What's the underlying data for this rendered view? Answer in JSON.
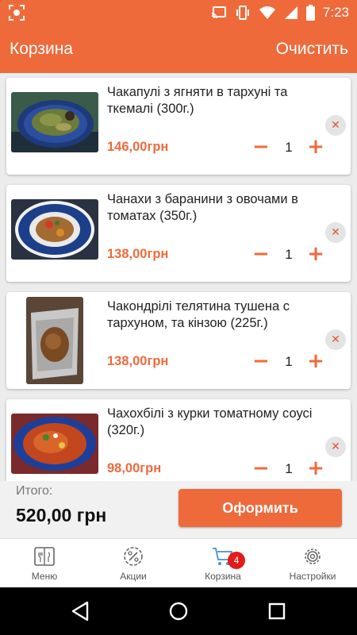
{
  "status_bar": {
    "time": "7:23"
  },
  "header": {
    "title": "Корзина",
    "clear_label": "Очистить"
  },
  "cart": {
    "items": [
      {
        "name": "Чакапулі з ягняти в тархуні та ткемалі (300г.)",
        "price": "146,00грн",
        "quantity": "1",
        "remove_icon": "✕",
        "minus_icon": "−",
        "plus_icon": "+"
      },
      {
        "name": "Чанахи з баранини з овочами в томатах (350г.)",
        "price": "138,00грн",
        "quantity": "1",
        "remove_icon": "✕",
        "minus_icon": "−",
        "plus_icon": "+"
      },
      {
        "name": "Чакондрілі телятина тушена с тархуном, та кінзою (225г.)",
        "price": "138,00грн",
        "quantity": "1",
        "remove_icon": "✕",
        "minus_icon": "−",
        "plus_icon": "+"
      },
      {
        "name": "Чахохбілі з курки томатному соусі (320г.)",
        "price": "98,00грн",
        "quantity": "1",
        "remove_icon": "✕",
        "minus_icon": "−",
        "plus_icon": "+"
      }
    ]
  },
  "summary": {
    "total_label": "Итого:",
    "total_value": "520,00 грн",
    "checkout_label": "Оформить"
  },
  "tabs": [
    {
      "label": "Меню",
      "icon": "menu-book-icon"
    },
    {
      "label": "Акции",
      "icon": "discount-icon"
    },
    {
      "label": "Корзина",
      "icon": "cart-icon",
      "badge": "4"
    },
    {
      "label": "Настройки",
      "icon": "gear-icon"
    }
  ],
  "colors": {
    "accent": "#ef6a3b",
    "badge": "#e31b1b"
  }
}
